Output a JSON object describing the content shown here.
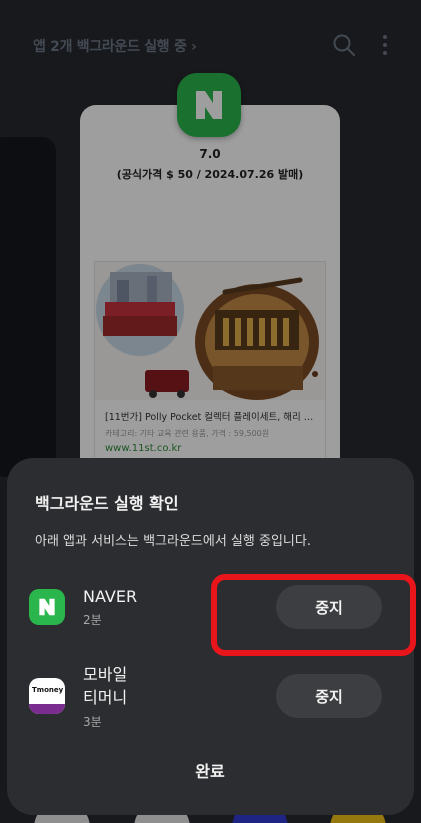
{
  "header": {
    "title": "앱 2개 백그라운드 실행 중 ›",
    "search_icon": "search-icon",
    "more_icon": "more-vert-icon"
  },
  "recent_app_card": {
    "app_logo_letter": "N",
    "rating": "7.0",
    "price_line": "(공식가격 $ 50 / 2024.07.26 발매)",
    "product_title": "[11번가] Polly Pocket 컬렉터 플레이세트, 해리 포...",
    "product_desc": "카테고리: 기타 교육 관련 용품, 가격 : 59,500원",
    "product_url": "www.11st.co.kr"
  },
  "sheet": {
    "title": "백그라운드 실행 확인",
    "description": "아래 앱과 서비스는 백그라운드에서 실행 중입니다.",
    "apps": [
      {
        "name": "NAVER",
        "time": "2분",
        "icon": "naver-icon",
        "stop_label": "중지",
        "logo_letter": "N"
      },
      {
        "name_line1": "모바일",
        "name_line2": "티머니",
        "time": "3분",
        "icon": "tmoney-icon",
        "stop_label": "중지",
        "logo_text": "Tmoney"
      }
    ],
    "done_label": "완료"
  },
  "colors": {
    "naver_green": "#2ab64c",
    "tmoney_purple": "#7b2c8f",
    "highlight_red": "#e8151b",
    "sheet_background": "#2c2d30"
  }
}
